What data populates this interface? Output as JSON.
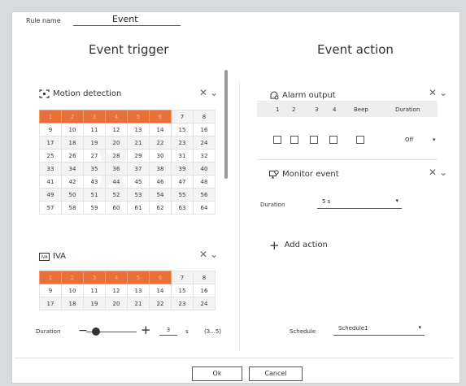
{
  "rule": {
    "label": "Rule name",
    "value": "Event"
  },
  "headings": {
    "trigger": "Event trigger",
    "action": "Event action"
  },
  "motion": {
    "title": "Motion detection",
    "icon": "motion-detection-icon",
    "channels": [
      [
        "1",
        "2",
        "3",
        "4",
        "5",
        "6",
        "7",
        "8"
      ],
      [
        "9",
        "10",
        "11",
        "12",
        "13",
        "14",
        "15",
        "16"
      ],
      [
        "17",
        "18",
        "19",
        "20",
        "21",
        "22",
        "23",
        "24"
      ],
      [
        "25",
        "26",
        "27",
        "28",
        "29",
        "30",
        "31",
        "32"
      ],
      [
        "33",
        "34",
        "35",
        "36",
        "37",
        "38",
        "39",
        "40"
      ],
      [
        "41",
        "42",
        "43",
        "44",
        "45",
        "46",
        "47",
        "48"
      ],
      [
        "49",
        "50",
        "51",
        "52",
        "53",
        "54",
        "55",
        "56"
      ],
      [
        "57",
        "58",
        "59",
        "60",
        "61",
        "62",
        "63",
        "64"
      ]
    ],
    "selected": [
      "1",
      "2",
      "3",
      "4",
      "5",
      "6"
    ]
  },
  "iva": {
    "title": "IVA",
    "icon": "iva-icon",
    "channels": [
      [
        "1",
        "2",
        "3",
        "4",
        "5",
        "6",
        "7",
        "8"
      ],
      [
        "9",
        "10",
        "11",
        "12",
        "13",
        "14",
        "15",
        "16"
      ],
      [
        "17",
        "18",
        "19",
        "20",
        "21",
        "22",
        "23",
        "24"
      ]
    ],
    "selected": [
      "1",
      "2",
      "3",
      "4",
      "5",
      "6"
    ]
  },
  "alarm": {
    "title": "Alarm output",
    "icon": "alarm-output-icon",
    "columns": [
      "1",
      "2",
      "3",
      "4",
      "Beep",
      "Duration"
    ],
    "duration_value": "Off"
  },
  "monitor": {
    "title": "Monitor event",
    "icon": "monitor-event-icon",
    "duration_label": "Duration",
    "duration_value": "5 s"
  },
  "add_action": {
    "label": "Add action"
  },
  "trigger_duration": {
    "label": "Duration",
    "value": "3",
    "unit": "s",
    "range": "(3...5)"
  },
  "schedule": {
    "label": "Schedule",
    "value": "Schedule1"
  },
  "buttons": {
    "ok": "Ok",
    "cancel": "Cancel"
  },
  "colors": {
    "selected_channel": "#e8703a",
    "accent_line": "#555555"
  }
}
